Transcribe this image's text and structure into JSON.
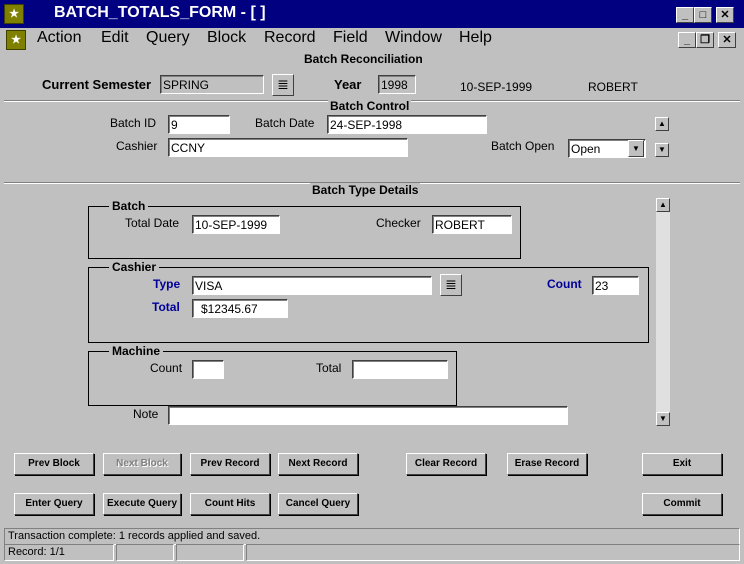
{
  "window": {
    "title": "BATCH_TOTALS_FORM - [ ]"
  },
  "menu": [
    "Action",
    "Edit",
    "Query",
    "Block",
    "Record",
    "Field",
    "Window",
    "Help"
  ],
  "header": {
    "form_title": "Batch Reconciliation",
    "current_semester_label": "Current Semester",
    "current_semester_value": "SPRING",
    "year_label": "Year",
    "year_value": "1998",
    "date": "10-SEP-1999",
    "user": "ROBERT"
  },
  "batch_control": {
    "title": "Batch Control",
    "batch_id_label": "Batch ID",
    "batch_id_value": "9",
    "batch_date_label": "Batch Date",
    "batch_date_value": "24-SEP-1998",
    "cashier_label": "Cashier",
    "cashier_value": "CCNY",
    "batch_open_label": "Batch Open",
    "batch_open_value": "Open"
  },
  "batch_type_details": {
    "title": "Batch Type Details",
    "batch": {
      "title": "Batch",
      "total_date_label": "Total Date",
      "total_date_value": "10-SEP-1999",
      "checker_label": "Checker",
      "checker_value": "ROBERT"
    },
    "cashier": {
      "title": "Cashier",
      "type_label": "Type",
      "type_value": "VISA",
      "count_label": "Count",
      "count_value": "23",
      "total_label": "Total",
      "total_value": "$12345.67"
    },
    "machine": {
      "title": "Machine",
      "count_label": "Count",
      "count_value": "",
      "total_label": "Total",
      "total_value": ""
    },
    "note_label": "Note",
    "note_value": ""
  },
  "buttons": {
    "prev_block": "Prev Block",
    "next_block": "Next Block",
    "prev_record": "Prev Record",
    "next_record": "Next Record",
    "clear_record": "Clear Record",
    "erase_record": "Erase Record",
    "exit": "Exit",
    "enter_query": "Enter Query",
    "execute_query": "Execute Query",
    "count_hits": "Count Hits",
    "cancel_query": "Cancel Query",
    "commit": "Commit"
  },
  "status": {
    "message": "Transaction complete: 1 records applied and saved.",
    "record": "Record: 1/1"
  }
}
